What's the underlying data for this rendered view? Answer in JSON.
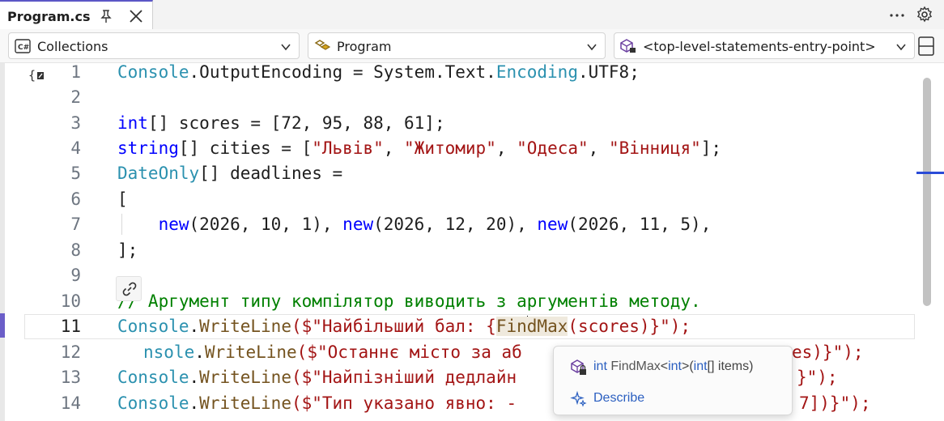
{
  "tab": {
    "title": "Program.cs"
  },
  "navbar": {
    "project": "Collections",
    "type": "Program",
    "member": "<top-level-statements-entry-point>"
  },
  "editor": {
    "line_numbers": [
      "1",
      "2",
      "3",
      "4",
      "5",
      "6",
      "7",
      "8",
      "9",
      "10",
      "11",
      "12",
      "13",
      "14"
    ],
    "active_line": "11",
    "lines": {
      "l1": [
        {
          "c": "t",
          "v": "Console"
        },
        {
          "c": "p",
          "v": "."
        },
        {
          "c": "p",
          "v": "OutputEncoding = System.Text."
        },
        {
          "c": "t",
          "v": "Encoding"
        },
        {
          "c": "p",
          "v": ".UTF8;"
        }
      ],
      "l3": [
        {
          "c": "k",
          "v": "int"
        },
        {
          "c": "p",
          "v": "[] "
        },
        {
          "c": "p",
          "v": "scores = [72, 95, 88, 61];"
        }
      ],
      "l4": [
        {
          "c": "k",
          "v": "string"
        },
        {
          "c": "p",
          "v": "[] "
        },
        {
          "c": "p",
          "v": "cities = ["
        },
        {
          "c": "s",
          "v": "\"Львів\""
        },
        {
          "c": "p",
          "v": ", "
        },
        {
          "c": "s",
          "v": "\"Житомир\""
        },
        {
          "c": "p",
          "v": ", "
        },
        {
          "c": "s",
          "v": "\"Одеса\""
        },
        {
          "c": "p",
          "v": ", "
        },
        {
          "c": "s",
          "v": "\"Вінниця\""
        },
        {
          "c": "p",
          "v": "];"
        }
      ],
      "l5": [
        {
          "c": "t",
          "v": "DateOnly"
        },
        {
          "c": "p",
          "v": "[] "
        },
        {
          "c": "p",
          "v": "deadlines ="
        }
      ],
      "l6": [
        {
          "c": "p",
          "v": "["
        }
      ],
      "l7": [
        {
          "c": "p",
          "v": "    "
        },
        {
          "c": "k",
          "v": "new"
        },
        {
          "c": "p",
          "v": "(2026, 10, 1), "
        },
        {
          "c": "k",
          "v": "new"
        },
        {
          "c": "p",
          "v": "(2026, 12, 20), "
        },
        {
          "c": "k",
          "v": "new"
        },
        {
          "c": "p",
          "v": "(2026, 11, 5),"
        }
      ],
      "l8": [
        {
          "c": "p",
          "v": "];"
        }
      ],
      "l10": [
        {
          "c": "c",
          "v": "// Аргумент типу компілятор виводить з аргументів методу."
        }
      ],
      "l11_a": "Console",
      "l11_b": ".",
      "l11_c": "WriteLine",
      "l11_d": "($\"Найбільший бал: {",
      "l11_e": "Fin",
      "l11_f": "dMax",
      "l11_g": "(scores)}\");",
      "l12_a": "nsole",
      "l12_b": ".",
      "l12_c": "WriteLine",
      "l12_d": "($\"Останнє місто за аб",
      "l12_e": "es)}\");",
      "l13_a": "Console",
      "l13_b": ".",
      "l13_c": "WriteLine",
      "l13_d": "($\"Найпізніший дедлайн",
      "l13_e": "}\");",
      "l14_a": "Console",
      "l14_b": ".",
      "l14_c": "WriteLine",
      "l14_d": "($\"Тип указано явно: -",
      "l14_e": "7])}\");"
    }
  },
  "popup": {
    "sig_return": "int",
    "sig_name": "FindMax",
    "sig_lt": "<",
    "sig_typearg": "int",
    "sig_gt_paren": ">(",
    "sig_param_type": "int",
    "sig_param_rest": "[] items)",
    "describe_label": "Describe"
  },
  "colors": {
    "type": "#2b91af",
    "keyword": "#0000ff",
    "string": "#a31515",
    "comment": "#008000",
    "method": "#74531f",
    "accent": "#6b5ec8"
  },
  "icons": [
    "pin-icon",
    "close-icon",
    "more-icon",
    "gear-icon",
    "csharp-project-icon",
    "class-icon",
    "method-icon",
    "chevron-down-icon",
    "split-icon",
    "code-icon",
    "link-icon",
    "method-lock-icon",
    "sparkle-icon"
  ]
}
